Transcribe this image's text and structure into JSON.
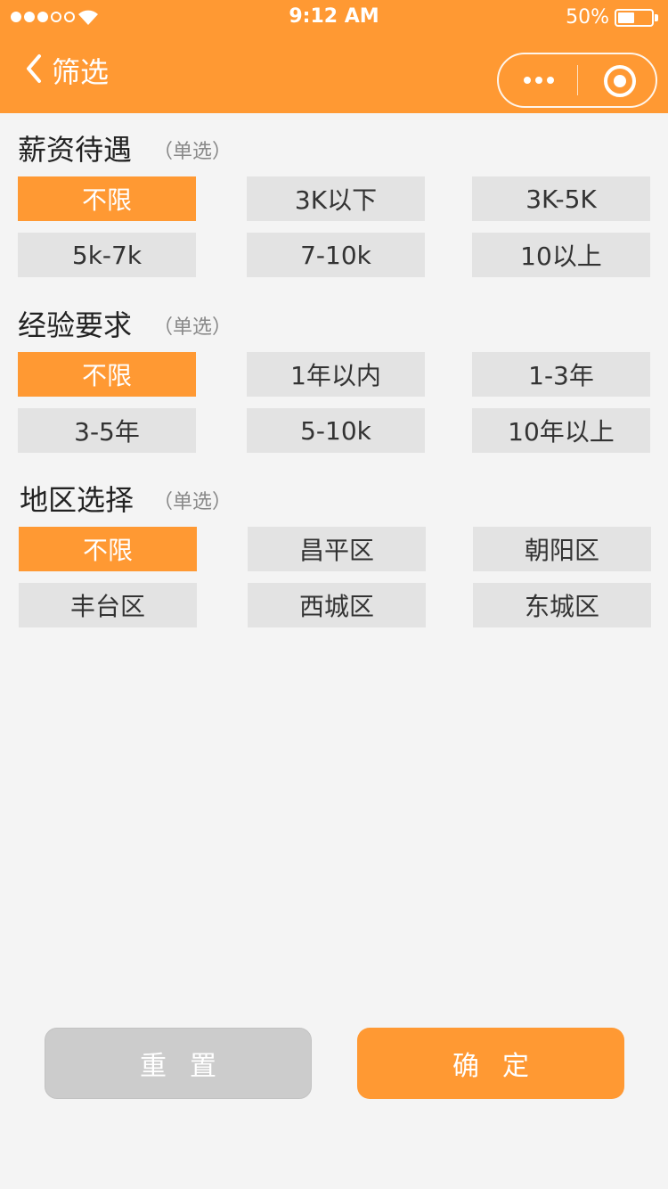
{
  "status_bar": {
    "time": "9:12 AM",
    "battery": "50%",
    "battery_level": 0.5
  },
  "header": {
    "title": "筛选"
  },
  "sections": [
    {
      "title": "薪资待遇",
      "hint": "（单选）",
      "options": [
        "不限",
        "3K以下",
        "3K-5K",
        "5k-7k",
        "7-10k",
        "10以上"
      ],
      "selected": 0
    },
    {
      "title": "经验要求",
      "hint": "（单选）",
      "options": [
        "不限",
        "1年以内",
        "1-3年",
        "3-5年",
        "5-10k",
        "10年以上"
      ],
      "selected": 0
    },
    {
      "title": "地区选择",
      "hint": "（单选）",
      "options": [
        "不限",
        "昌平区",
        "朝阳区",
        "丰台区",
        "西城区",
        "东城区"
      ],
      "selected": 0
    }
  ],
  "footer": {
    "reset_label": "重置",
    "confirm_label": "确定"
  },
  "colors": {
    "accent": "#ff9933",
    "option_bg": "#e3e3e3",
    "page_bg": "#f4f4f4",
    "reset_bg": "#cccccc"
  }
}
